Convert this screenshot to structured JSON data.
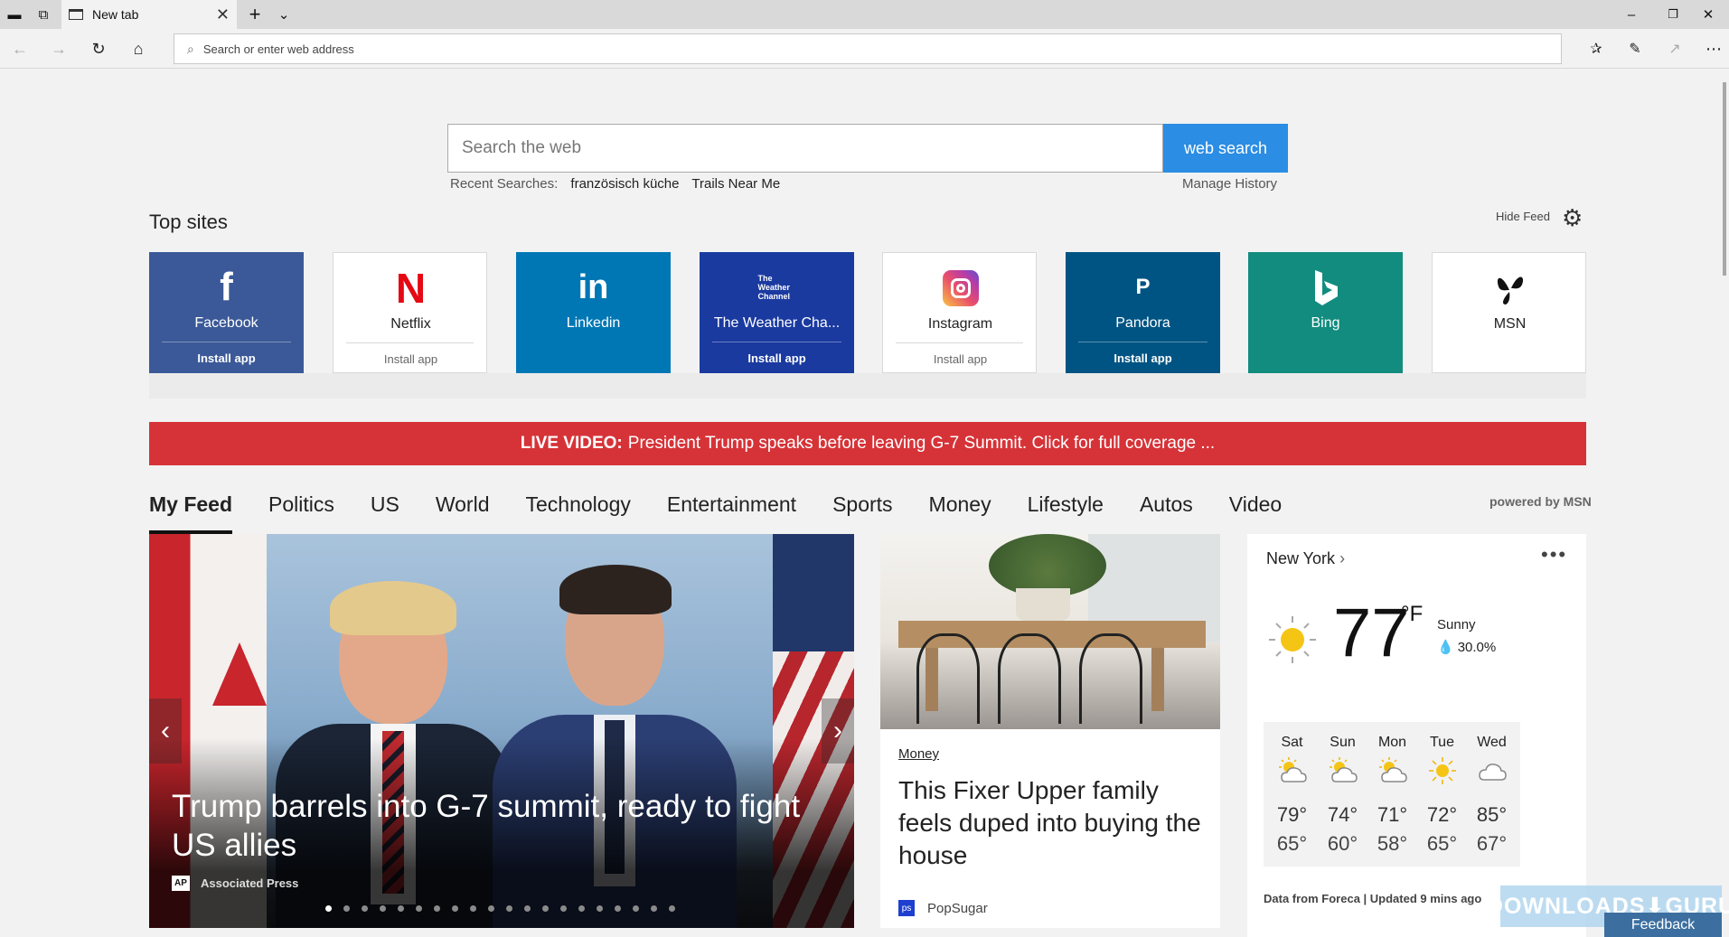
{
  "browser": {
    "tab_title": "New tab",
    "address_placeholder": "Search or enter web address"
  },
  "search": {
    "placeholder": "Search the web",
    "button": "web search",
    "recent_label": "Recent Searches:",
    "recent_terms": [
      "französisch küche",
      "Trails Near Me"
    ],
    "manage_history": "Manage History"
  },
  "top_sites": {
    "title": "Top sites",
    "hide_feed": "Hide Feed",
    "tiles": [
      {
        "name": "Facebook",
        "install": "Install app",
        "color": "#3b5998",
        "logo": "f"
      },
      {
        "name": "Netflix",
        "install": "Install app",
        "color": "#ffffff",
        "logo": "N"
      },
      {
        "name": "Linkedin",
        "install": "",
        "color": "#0077b5",
        "logo": "in"
      },
      {
        "name": "The Weather Cha...",
        "install": "Install app",
        "color": "#1a3aa0",
        "logo": "The Weather Channel"
      },
      {
        "name": "Instagram",
        "install": "Install app",
        "color": "#ffffff",
        "logo": "instagram-icon"
      },
      {
        "name": "Pandora",
        "install": "Install app",
        "color": "#005483",
        "logo": "P"
      },
      {
        "name": "Bing",
        "install": "",
        "color": "#128c7e",
        "logo": "bing-icon"
      },
      {
        "name": "MSN",
        "install": "",
        "color": "#ffffff",
        "logo": "msn-butterfly-icon"
      }
    ]
  },
  "banner": {
    "bold": "LIVE VIDEO:",
    "text": "President Trump speaks before leaving G-7 Summit. Click for full coverage ...",
    "color": "#d63338"
  },
  "feed": {
    "tabs": [
      "My Feed",
      "Politics",
      "US",
      "World",
      "Technology",
      "Entertainment",
      "Sports",
      "Money",
      "Lifestyle",
      "Autos",
      "Video"
    ],
    "active_tab": "My Feed",
    "powered_by": "powered by MSN"
  },
  "hero": {
    "headline": "Trump barrels into G-7 summit, ready to fight US allies",
    "source": "Associated Press",
    "source_logo": "AP",
    "slide_count": 20,
    "active_slide": 1
  },
  "article": {
    "category": "Money",
    "headline": "This Fixer Upper family feels duped into buying the house",
    "source": "PopSugar"
  },
  "weather": {
    "city": "New York",
    "temp": "77",
    "unit": "°F",
    "condition": "Sunny",
    "precip": "30.0%",
    "forecast": [
      {
        "day": "Sat",
        "hi": "79°",
        "lo": "65°",
        "icon": "partly-sunny"
      },
      {
        "day": "Sun",
        "hi": "74°",
        "lo": "60°",
        "icon": "partly-sunny"
      },
      {
        "day": "Mon",
        "hi": "71°",
        "lo": "58°",
        "icon": "partly-sunny"
      },
      {
        "day": "Tue",
        "hi": "72°",
        "lo": "65°",
        "icon": "sunny"
      },
      {
        "day": "Wed",
        "hi": "85°",
        "lo": "67°",
        "icon": "cloudy"
      }
    ],
    "data_from": "Data from Foreca | Updated 9 mins ago"
  },
  "overlay": {
    "watermark": "DOWNLOADS⬇GURU",
    "feedback": "Feedback"
  }
}
